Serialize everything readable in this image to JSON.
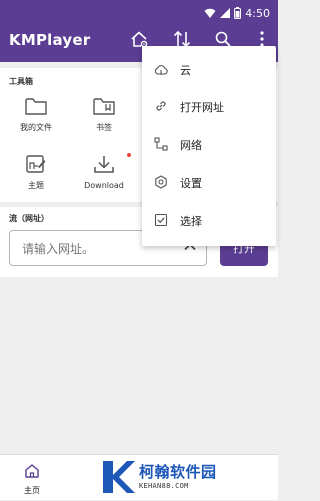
{
  "status": {
    "time": "4:50"
  },
  "appbar": {
    "title": "KMPlayer"
  },
  "toolbox": {
    "title": "工具箱",
    "tools": [
      {
        "label": "我的文件",
        "icon": "folder-icon"
      },
      {
        "label": "书签",
        "icon": "bookmark-folder-icon"
      },
      {
        "label": "主题",
        "icon": "theme-icon"
      },
      {
        "label": "Download",
        "icon": "download-icon"
      }
    ]
  },
  "stream": {
    "title": "流（网址）",
    "placeholder": "请输入网址。",
    "open_label": "打开"
  },
  "menu": {
    "items": [
      {
        "label": "云",
        "icon": "cloud-icon"
      },
      {
        "label": "打开网址",
        "icon": "link-icon"
      },
      {
        "label": "网络",
        "icon": "network-icon"
      },
      {
        "label": "设置",
        "icon": "gear-icon"
      },
      {
        "label": "选择",
        "icon": "checkbox-icon"
      }
    ]
  },
  "bottom_nav": {
    "home_label": "主页"
  },
  "watermark": {
    "text": "柯翰软件园",
    "sub": "KEHAN88.COM"
  },
  "colors": {
    "primary": "#5b3e93",
    "badge": "#f44336",
    "watermark": "#1d57b8"
  }
}
